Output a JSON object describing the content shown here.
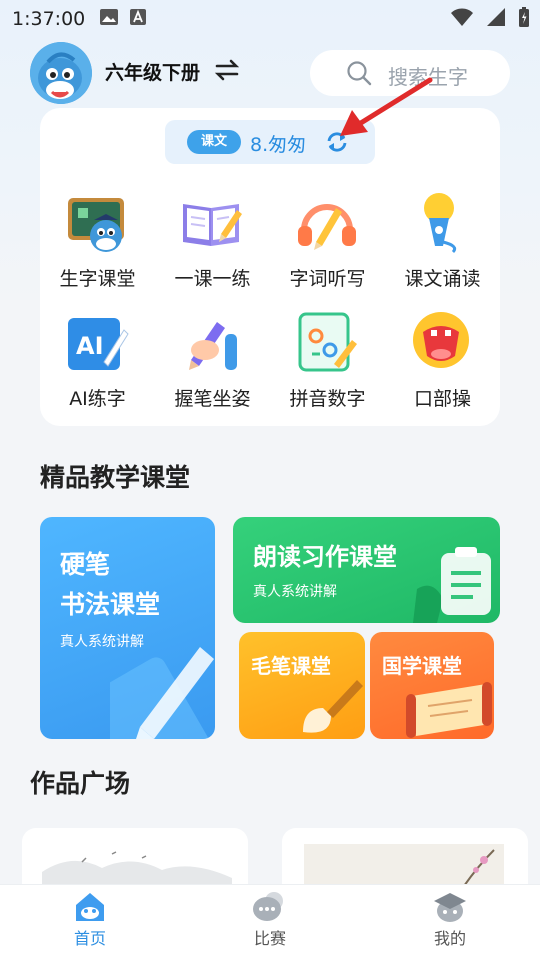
{
  "status_bar": {
    "time": "1:37:00"
  },
  "header": {
    "grade": "六年级下册",
    "search_placeholder": "搜索生字"
  },
  "lesson": {
    "tag": "课文",
    "name": "8.匆匆"
  },
  "features": [
    {
      "label": "生字课堂",
      "icon": "blackboard-icon"
    },
    {
      "label": "一课一练",
      "icon": "book-pencil-icon"
    },
    {
      "label": "字词听写",
      "icon": "headphones-icon"
    },
    {
      "label": "课文诵读",
      "icon": "microphone-icon"
    },
    {
      "label": "AI练字",
      "icon": "ai-icon"
    },
    {
      "label": "握笔坐姿",
      "icon": "pencil-grip-icon"
    },
    {
      "label": "拼音数字",
      "icon": "pinyin-icon"
    },
    {
      "label": "口部操",
      "icon": "mouth-icon"
    }
  ],
  "courses": {
    "section_title": "精品教学课堂",
    "hard_pen": {
      "title_line1": "硬笔",
      "title_line2": "书法课堂",
      "subtitle": "真人系统讲解"
    },
    "reading": {
      "title": "朗读习作课堂",
      "subtitle": "真人系统讲解"
    },
    "brush": {
      "title": "毛笔课堂"
    },
    "guoxue": {
      "title": "国学课堂"
    }
  },
  "works": {
    "section_title": "作品广场"
  },
  "bottom_nav": [
    {
      "label": "首页",
      "active": true
    },
    {
      "label": "比赛",
      "active": false
    },
    {
      "label": "我的",
      "active": false
    }
  ],
  "colors": {
    "accent": "#2d8fe2",
    "green": "#22c16b",
    "orange": "#ff7a2f",
    "yellow": "#ffb01f",
    "blue": "#3fa4ef"
  }
}
